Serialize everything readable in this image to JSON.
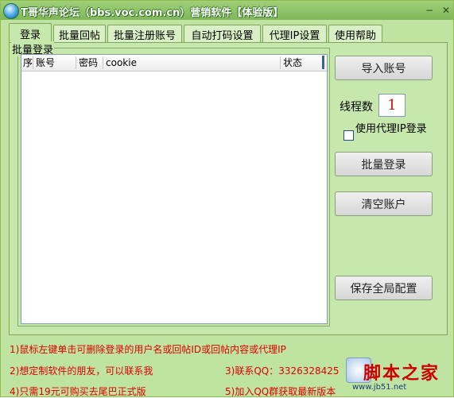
{
  "window": {
    "title": "T哥华声论坛（bbs.voc.com.cn）营销软件【体验版】",
    "min_glyph": "−",
    "close_glyph": "✕"
  },
  "tabs": [
    {
      "label": "登录"
    },
    {
      "label": "批量回帖"
    },
    {
      "label": "批量注册账号"
    },
    {
      "label": "自动打码设置"
    },
    {
      "label": "代理IP设置"
    },
    {
      "label": "使用帮助"
    }
  ],
  "group": {
    "title": "批量登录"
  },
  "table": {
    "columns": [
      "序",
      "账号",
      "密码",
      "cookie",
      "状态"
    ],
    "rows": []
  },
  "buttons": {
    "import": "导入账号",
    "batch_login": "批量登录",
    "clear": "清空账户",
    "save": "保存全局配置"
  },
  "threads": {
    "label": "线程数",
    "value": "1"
  },
  "proxy": {
    "label": "使用代理IP登录",
    "checked": false
  },
  "info": {
    "line1": "1)鼠标左键单击可删除登录的用户名或回帖ID或回帖内容或代理IP",
    "line2": "2)想定制软件的朋友，可以联系我",
    "line3": "3)联系QQ：3326328425",
    "line4": "4)只需19元可购买去尾巴正式版",
    "line5": "5)加入QQ群获取最新版本"
  },
  "watermark": {
    "text": "脚本之家",
    "url": "www.jb51.net"
  },
  "colors": {
    "accent_text": "#e00000",
    "window_bg": "#c7e8ad"
  }
}
